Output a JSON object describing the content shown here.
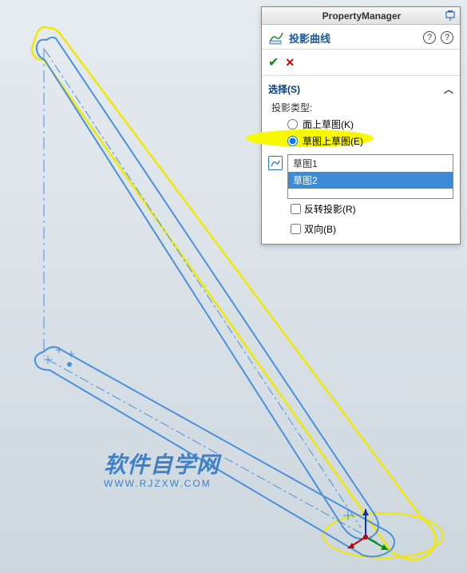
{
  "panel": {
    "title": "PropertyManager",
    "feature_name": "投影曲线",
    "section_header": "选择(S)",
    "projection_type_label": "投影类型:",
    "radio": {
      "on_face": "面上草图(K)",
      "on_sketch": "草图上草图(E)"
    },
    "selection_items": [
      "草图1",
      "草图2"
    ],
    "checkboxes": {
      "reverse": "反转投影(R)",
      "bidirectional": "双向(B)"
    }
  },
  "watermark": {
    "cn": "软件自学网",
    "en": "WWW.RJZXW.COM"
  },
  "chart_data": {
    "type": "3d-sketch",
    "description": "SolidWorks 3D viewport showing two sketch profiles (elongated slot shapes) and a projected curve",
    "entities": [
      {
        "name": "草图1",
        "type": "sketch",
        "shape": "slot",
        "color": "#4a90d9",
        "plane": "bottom-horizontal"
      },
      {
        "name": "草图2",
        "type": "sketch",
        "shape": "slot",
        "color": "#4a90d9",
        "plane": "front-vertical"
      },
      {
        "name": "projected-curve",
        "type": "curve",
        "shape": "ellipse-slot",
        "color": "#f0e800"
      },
      {
        "name": "origin-triad",
        "type": "coordinate-system",
        "location": "bottom-right"
      }
    ]
  }
}
